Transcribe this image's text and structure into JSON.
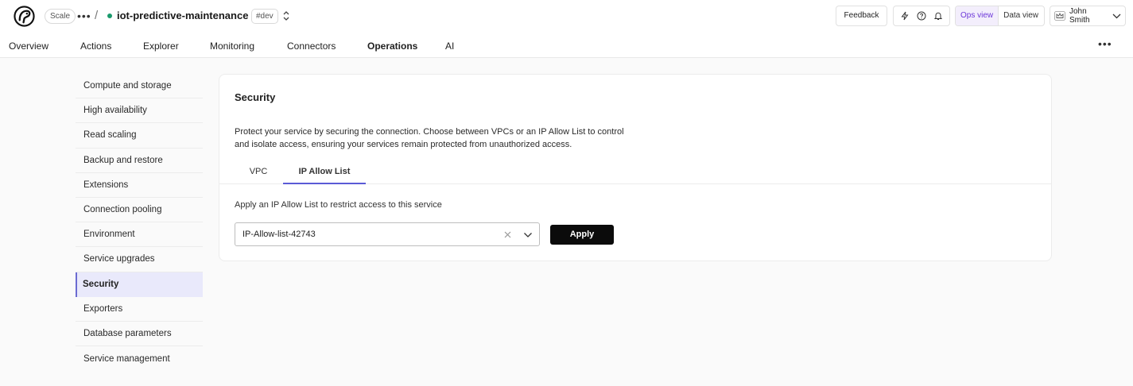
{
  "header": {
    "plan_badge": "Scale",
    "service_name": "iot-predictive-maintenance",
    "env_badge": "#dev",
    "feedback_label": "Feedback",
    "ops_view_label": "Ops view",
    "data_view_label": "Data view",
    "user_name": "John Smith",
    "status_color": "#1a9a6c",
    "accent_color": "#6d38d8"
  },
  "nav": {
    "tabs": [
      {
        "label": "Overview"
      },
      {
        "label": "Actions"
      },
      {
        "label": "Explorer"
      },
      {
        "label": "Monitoring"
      },
      {
        "label": "Connectors"
      },
      {
        "label": "Operations"
      },
      {
        "label": "AI"
      }
    ]
  },
  "sidebar": {
    "items": [
      {
        "label": "Compute and storage"
      },
      {
        "label": "High availability"
      },
      {
        "label": "Read scaling"
      },
      {
        "label": "Backup and restore"
      },
      {
        "label": "Extensions"
      },
      {
        "label": "Connection pooling"
      },
      {
        "label": "Environment"
      },
      {
        "label": "Service upgrades"
      },
      {
        "label": "Security"
      },
      {
        "label": "Exporters"
      },
      {
        "label": "Database parameters"
      },
      {
        "label": "Service management"
      }
    ]
  },
  "security": {
    "title": "Security",
    "description": "Protect your service by securing the connection. Choose between VPCs or an IP Allow List to control and isolate access, ensuring your services remain protected from unauthorized access.",
    "tabs": [
      {
        "label": "VPC"
      },
      {
        "label": "IP Allow List"
      }
    ],
    "apply_label": "Apply an IP Allow List to restrict access to this service",
    "selected_list": "IP-Allow-list-42743",
    "apply_button": "Apply"
  }
}
